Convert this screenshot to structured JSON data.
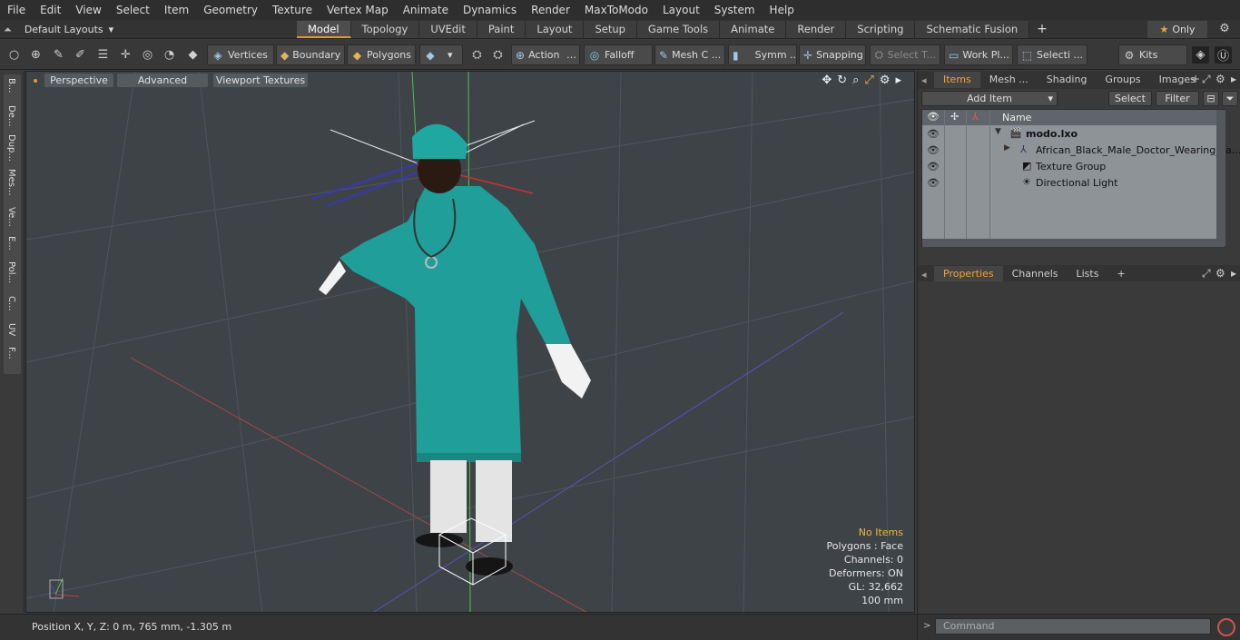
{
  "menubar": {
    "items": [
      "File",
      "Edit",
      "View",
      "Select",
      "Item",
      "Geometry",
      "Texture",
      "Vertex Map",
      "Animate",
      "Dynamics",
      "Render",
      "MaxToModo",
      "Layout",
      "System",
      "Help"
    ]
  },
  "layoutbar": {
    "layout_name": "Default Layouts",
    "tabs": [
      "Model",
      "Topology",
      "UVEdit",
      "Paint",
      "Layout",
      "Setup",
      "Game Tools",
      "Animate",
      "Render",
      "Scripting",
      "Schematic Fusion"
    ],
    "active_tab": "Model",
    "only_label": "Only"
  },
  "toolbar": {
    "vertices": "Vertices",
    "boundary": "Boundary",
    "polygons": "Polygons",
    "action": "Action",
    "falloff": "Falloff",
    "mesh_c": "Mesh C ...",
    "symm": "Symm ...",
    "snapping": "Snapping",
    "select_t": "Select T...",
    "work_pl": "Work Pl...",
    "selecti": "Selecti ...",
    "kits": "Kits"
  },
  "left_strip": {
    "tabs": [
      "B...",
      "De...",
      "Dup...",
      "Mes...",
      "Ve...",
      "E...",
      "Pol...",
      "C...",
      "UV",
      "F..."
    ]
  },
  "viewport": {
    "perspective_label": "Perspective",
    "advanced_label": "Advanced",
    "textures_label": "Viewport Textures",
    "info": {
      "no_items": "No Items",
      "polygons": "Polygons : Face",
      "channels": "Channels: 0",
      "deformers": "Deformers: ON",
      "gl": "GL: 32,662",
      "scale": "100 mm"
    }
  },
  "statusbar": {
    "position_text": "Position X, Y, Z:   0 m, 765 mm, -1.305 m"
  },
  "right_panel": {
    "top_tabs": [
      "Items",
      "Mesh ...",
      "Shading",
      "Groups",
      "Images"
    ],
    "active_top_tab": "Items",
    "add_item_label": "Add Item",
    "select_label": "Select",
    "filter_label": "Filter",
    "column_name": "Name",
    "items": [
      {
        "label": "modo.lxo",
        "bold": true
      },
      {
        "label": "African_Black_Male_Doctor_Wearing_Fa...",
        "bold": false
      },
      {
        "label": "Texture Group",
        "bold": false
      },
      {
        "label": "Directional Light",
        "bold": false
      }
    ],
    "bottom_tabs": [
      "Properties",
      "Channels",
      "Lists"
    ],
    "active_bottom_tab": "Properties",
    "command_placeholder": "Command"
  }
}
